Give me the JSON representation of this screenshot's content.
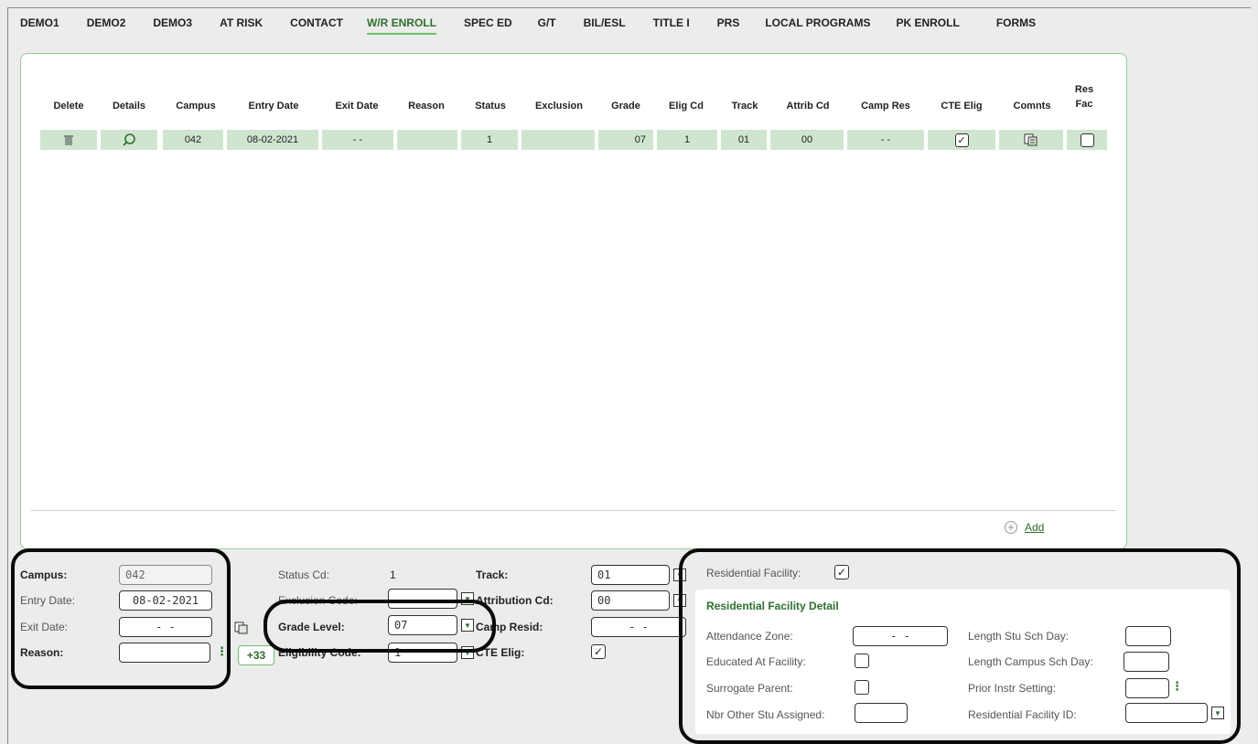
{
  "tabs": [
    {
      "label": "DEMO1",
      "active": false
    },
    {
      "label": "DEMO2",
      "active": false
    },
    {
      "label": "DEMO3",
      "active": false
    },
    {
      "label": "AT RISK",
      "active": false
    },
    {
      "label": "CONTACT",
      "active": false
    },
    {
      "label": "W/R ENROLL",
      "active": true
    },
    {
      "label": "SPEC ED",
      "active": false
    },
    {
      "label": "G/T",
      "active": false
    },
    {
      "label": "BIL/ESL",
      "active": false
    },
    {
      "label": "TITLE I",
      "active": false
    },
    {
      "label": "PRS",
      "active": false
    },
    {
      "label": "LOCAL PROGRAMS",
      "active": false
    },
    {
      "label": "PK ENROLL",
      "active": false
    },
    {
      "label": "FORMS",
      "active": false
    }
  ],
  "grid": {
    "columns": {
      "delete": "Delete",
      "details": "Details",
      "campus": "Campus",
      "entry_date": "Entry Date",
      "exit_date": "Exit Date",
      "reason": "Reason",
      "status": "Status",
      "exclusion": "Exclusion",
      "grade": "Grade",
      "elig_cd": "Elig Cd",
      "track": "Track",
      "attrib_cd": "Attrib Cd",
      "camp_res": "Camp Res",
      "cte_elig": "CTE Elig",
      "comnts": "Comnts",
      "res_fac_1": "Res",
      "res_fac_2": "Fac"
    },
    "row": {
      "campus": "042",
      "entry_date": "08-02-2021",
      "exit_date": "- -",
      "reason": "",
      "status": "1",
      "exclusion": "",
      "grade": "07",
      "elig_cd": "1",
      "track": "01",
      "attrib_cd": "00",
      "camp_res": "- -",
      "cte_elig": "✓",
      "res_fac": ""
    },
    "add_label": "Add"
  },
  "form": {
    "campus_label": "Campus:",
    "campus_value": "042",
    "entry_date_label": "Entry Date:",
    "entry_date_value": "08-02-2021",
    "exit_date_label": "Exit Date:",
    "exit_date_value": "- -",
    "reason_label": "Reason:",
    "reason_value": "",
    "plus33": "+33",
    "status_cd_label": "Status Cd:",
    "status_cd_value": "1",
    "exclusion_code_label": "Exclusion Code:",
    "grade_level_label": "Grade Level:",
    "grade_level_value": "07",
    "eligibility_code_label": "Eligibility Code:",
    "eligibility_code_value": "1",
    "track_label": "Track:",
    "track_value": "01",
    "attribution_cd_label": "Attribution Cd:",
    "attribution_cd_value": "00",
    "camp_resid_label": "Camp Resid:",
    "camp_resid_value": "- -",
    "cte_elig_label": "CTE Elig:",
    "cte_elig_value": "✓"
  },
  "residential": {
    "facility_label": "Residential Facility:",
    "facility_value": "✓",
    "detail_title": "Residential Facility Detail",
    "attendance_zone_label": "Attendance Zone:",
    "attendance_zone_value": "- -",
    "educated_label": "Educated At Facility:",
    "surrogate_label": "Surrogate Parent:",
    "nbr_other_label": "Nbr Other Stu Assigned:",
    "length_stu_label": "Length Stu Sch Day:",
    "length_campus_label": "Length Campus Sch Day:",
    "prior_instr_label": "Prior Instr Setting:",
    "facility_id_label": "Residential Facility ID:"
  }
}
